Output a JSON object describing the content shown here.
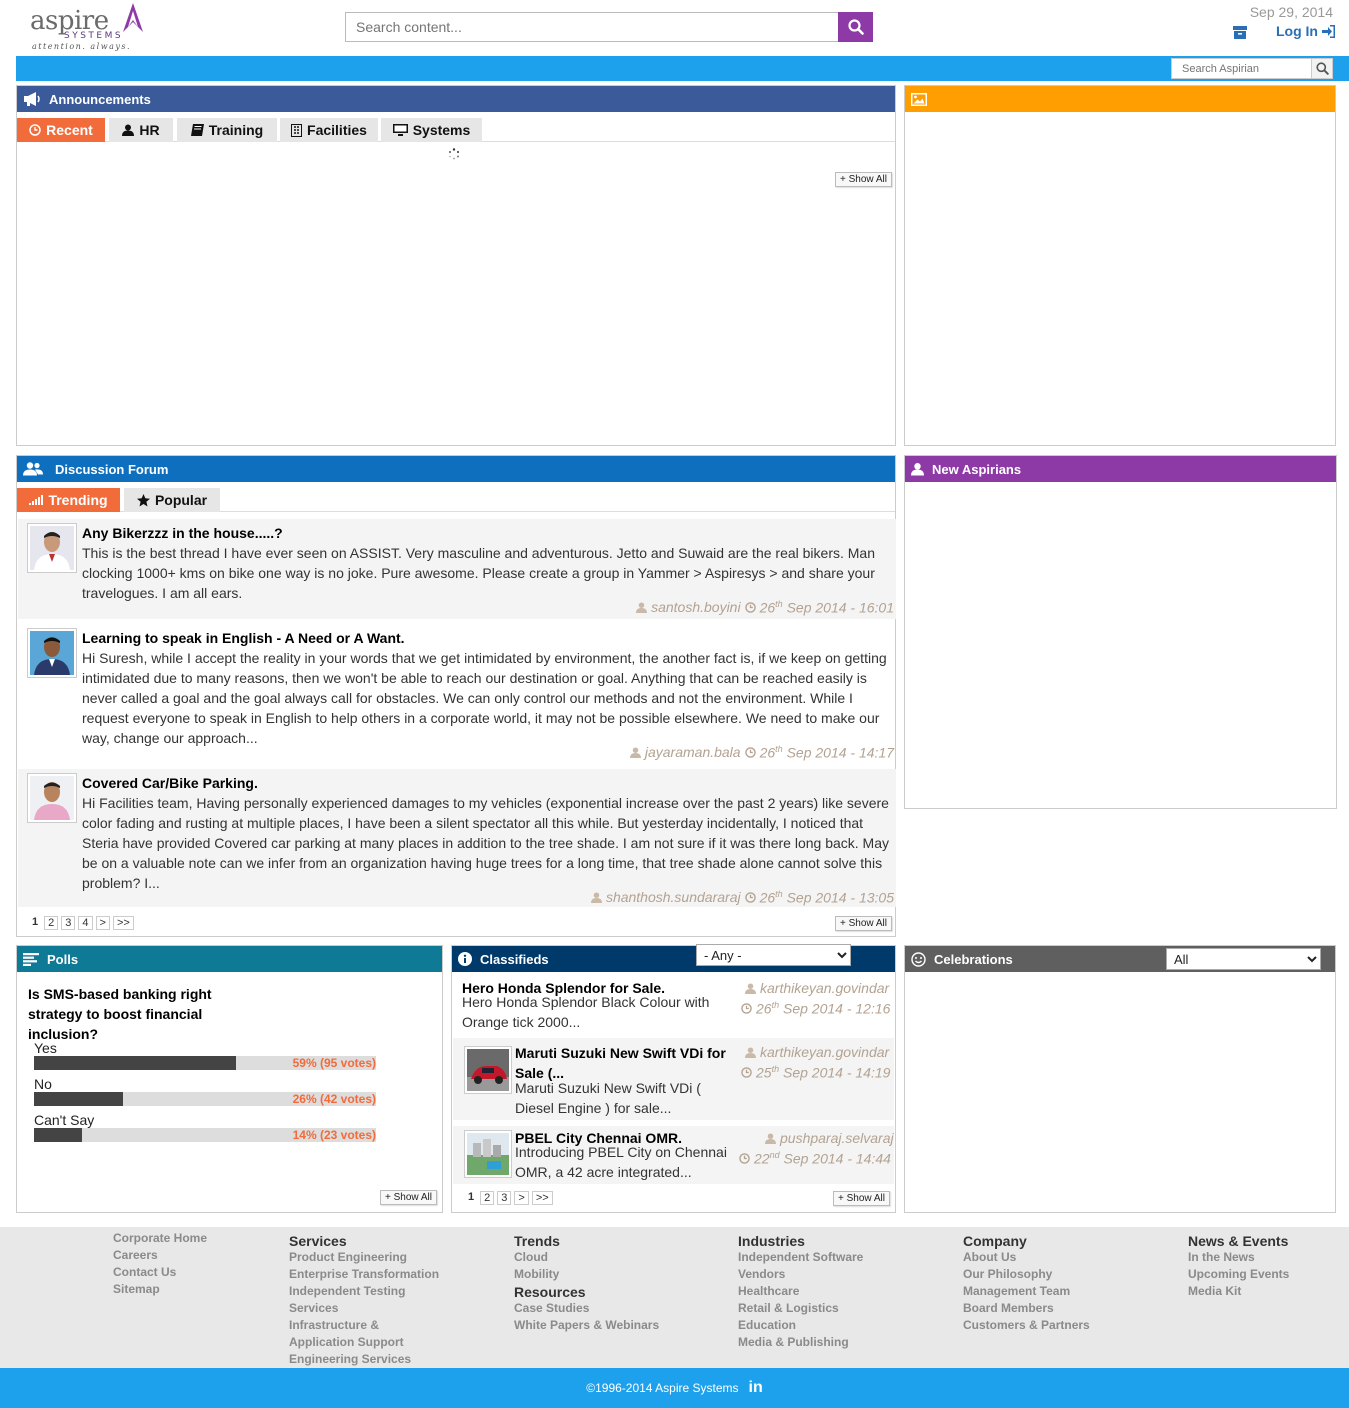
{
  "header": {
    "logo_word": "aspire",
    "logo_systems": "SYSTEMS",
    "logo_tagline": "attention. always.",
    "search_placeholder": "Search content...",
    "date": "Sep 29, 2014",
    "login_label": "Log In",
    "aspirian_search_placeholder": "Search Aspirian"
  },
  "colors": {
    "brand_purple": "#8e3aa6",
    "blue_bar": "#1ea1ec",
    "announcements_header": "#3a5a9a",
    "forum_header": "#0e6fbf",
    "gallery_header": "#ff9e00",
    "new_aspirians_header": "#8e3aa6",
    "polls_header": "#0e7a95",
    "classifieds_header": "#003a6b",
    "celebrations_header": "#5f5f5f",
    "active_tab": "#f26b3a"
  },
  "announcements": {
    "title": "Announcements",
    "tabs": [
      {
        "label": "Recent",
        "icon": "clock-icon"
      },
      {
        "label": "HR",
        "icon": "user-icon"
      },
      {
        "label": "Training",
        "icon": "book-icon"
      },
      {
        "label": "Facilities",
        "icon": "building-icon"
      },
      {
        "label": "Systems",
        "icon": "monitor-icon"
      }
    ],
    "show_all": "+ Show All"
  },
  "gallery": {
    "icon": "image-icon"
  },
  "forum": {
    "title": "Discussion Forum",
    "tabs": [
      {
        "label": "Trending",
        "icon": "signal-icon"
      },
      {
        "label": "Popular",
        "icon": "star-icon"
      }
    ],
    "posts": [
      {
        "title": "Any Bikerzzz in the house.....?",
        "body": "This is the best thread I have ever seen on ASSIST. Very masculine and adventurous. Jetto and Suwaid are the real bikers. Man clocking 1000+ kms on bike one way is no joke. Pure awesome. Please create a group in Yammer > Aspiresys > and share your travelogues. I am all ears.",
        "author": "santosh.boyini",
        "day": "26",
        "day_suffix": "th",
        "rest": " Sep 2014 - 16:01"
      },
      {
        "title": "Learning to speak in English - A Need or A Want.",
        "body": "Hi Suresh, while I accept the reality in your words that we get intimidated by environment, the another fact is, if we keep on getting intimidated due to many reasons, then we won't be able to reach our destination or goal. Anything that can be reached easily is never called a goal and the goal always call for obstacles. We can only control our methods and not the environment. While I request everyone to speak in English to help others in a corporate world, it may not be possible elsewhere. We need to make our way, change our approach...",
        "author": "jayaraman.bala",
        "day": "26",
        "day_suffix": "th",
        "rest": " Sep 2014 - 14:17"
      },
      {
        "title": "Covered Car/Bike Parking.",
        "body": "Hi Facilities team, Having personally experienced damages to my vehicles (exponential increase over the past 2 years) like severe color fading and rusting at multiple places, I have been a silent spectator all this while. But yesterday incidentally, I noticed that Steria have provided Covered car parking at many places in addition to the tree shade. I am not sure if it was there long back. May be on a valuable note can we infer from an organization having huge trees for a long time, that tree shade alone cannot solve this problem? I...",
        "author": "shanthosh.sundararaj",
        "day": "26",
        "day_suffix": "th",
        "rest": " Sep 2014 - 13:05"
      }
    ],
    "pages": [
      "1",
      "2",
      "3",
      "4",
      ">",
      ">>"
    ],
    "show_all": "+ Show All"
  },
  "new_aspirians": {
    "title": "New Aspirians"
  },
  "polls": {
    "title": "Polls",
    "question": "Is SMS-based banking right strategy to boost financial inclusion?",
    "options": [
      {
        "label": "Yes",
        "percent": 59,
        "result": "59% (95 votes)"
      },
      {
        "label": "No",
        "percent": 26,
        "result": "26% (42 votes)"
      },
      {
        "label": "Can't Say",
        "percent": 14,
        "result": "14% (23 votes)"
      }
    ],
    "show_all": "+ Show All"
  },
  "classifieds": {
    "title": "Classifieds",
    "filter_value": "- Any -",
    "items": [
      {
        "title": "Hero Honda Splendor for Sale.",
        "desc": "Hero Honda Splendor Black Colour with Orange tick 2000...",
        "author": "karthikeyan.govindar",
        "day": "26",
        "day_suffix": "th",
        "rest": " Sep 2014 - 12:16"
      },
      {
        "title": "Maruti Suzuki New Swift VDi for Sale (...",
        "desc": "Maruti Suzuki New Swift VDi ( Diesel Engine ) for sale...",
        "author": "karthikeyan.govindar",
        "day": "25",
        "day_suffix": "th",
        "rest": " Sep 2014 - 14:19"
      },
      {
        "title": "PBEL City Chennai OMR.",
        "desc": "Introducing PBEL City on Chennai OMR, a 42 acre integrated...",
        "author": "pushparaj.selvaraj",
        "day": "22",
        "day_suffix": "nd",
        "rest": " Sep 2014 - 14:44"
      }
    ],
    "pages": [
      "1",
      "2",
      "3",
      ">",
      ">>"
    ],
    "show_all": "+ Show All"
  },
  "celebrations": {
    "title": "Celebrations",
    "filter_value": "All"
  },
  "footer": {
    "col1": {
      "links": [
        "Corporate Home",
        "Careers",
        "Contact Us",
        "Sitemap"
      ]
    },
    "col2": {
      "heading": "Services",
      "links": [
        "Product Engineering",
        "Enterprise Transformation",
        "Independent Testing",
        "Services",
        "Infrastructure &",
        "Application Support",
        "Engineering Services"
      ]
    },
    "col3": {
      "heading": "Trends",
      "links": [
        "Cloud",
        "Mobility"
      ],
      "heading2": "Resources",
      "links2": [
        "Case Studies",
        "White Papers & Webinars"
      ]
    },
    "col4": {
      "heading": "Industries",
      "links": [
        "Independent Software",
        "Vendors",
        "Healthcare",
        "Retail & Logistics",
        "Education",
        "Media & Publishing"
      ]
    },
    "col5": {
      "heading": "Company",
      "links": [
        "About Us",
        "Our Philosophy",
        "Management Team",
        "Board Members",
        "Customers & Partners"
      ]
    },
    "col6": {
      "heading": "News & Events",
      "links": [
        "In the News",
        "Upcoming Events",
        "Media Kit"
      ]
    },
    "copyright": "©1996-2014 Aspire Systems",
    "social_label": "in"
  }
}
